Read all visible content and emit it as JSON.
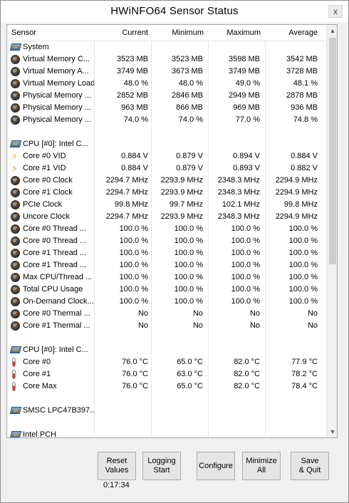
{
  "window": {
    "title": "HWiNFO64 Sensor Status",
    "close_label": "x"
  },
  "table": {
    "headers": {
      "sensor": "Sensor",
      "current": "Current",
      "minimum": "Minimum",
      "maximum": "Maximum",
      "average": "Average"
    },
    "rows": [
      {
        "type": "group",
        "icon": "chip-icon",
        "name": "System"
      },
      {
        "type": "sensor",
        "icon": "gauge-icon",
        "name": "Virtual Memory C...",
        "current": "3523 MB",
        "minimum": "3523 MB",
        "maximum": "3598 MB",
        "average": "3542 MB"
      },
      {
        "type": "sensor",
        "icon": "gauge-icon",
        "name": "Virtual Memory A...",
        "current": "3749 MB",
        "minimum": "3673 MB",
        "maximum": "3749 MB",
        "average": "3728 MB"
      },
      {
        "type": "sensor",
        "icon": "gauge-icon",
        "name": "Virtual Memory Load",
        "current": "48.0 %",
        "minimum": "48.0 %",
        "maximum": "49.0 %",
        "average": "48.1 %"
      },
      {
        "type": "sensor",
        "icon": "gauge-icon",
        "name": "Physical Memory ...",
        "current": "2852 MB",
        "minimum": "2846 MB",
        "maximum": "2949 MB",
        "average": "2878 MB"
      },
      {
        "type": "sensor",
        "icon": "gauge-icon",
        "name": "Physical Memory ...",
        "current": "963 MB",
        "minimum": "866 MB",
        "maximum": "969 MB",
        "average": "936 MB"
      },
      {
        "type": "sensor",
        "icon": "gauge-icon",
        "name": "Physical Memory ...",
        "current": "74.0 %",
        "minimum": "74.0 %",
        "maximum": "77.0 %",
        "average": "74.8 %"
      },
      {
        "type": "blank"
      },
      {
        "type": "group",
        "icon": "chip-icon",
        "name": "CPU [#0]: Intel C..."
      },
      {
        "type": "sensor",
        "icon": "bolt-icon",
        "name": "Core #0 VID",
        "current": "0.884 V",
        "minimum": "0.879 V",
        "maximum": "0.894 V",
        "average": "0.884 V"
      },
      {
        "type": "sensor",
        "icon": "bolt-icon",
        "name": "Core #1 VID",
        "current": "0.884 V",
        "minimum": "0.879 V",
        "maximum": "0.893 V",
        "average": "0.882 V"
      },
      {
        "type": "sensor",
        "icon": "gauge-icon",
        "name": "Core #0 Clock",
        "current": "2294.7 MHz",
        "minimum": "2293.9 MHz",
        "maximum": "2348.3 MHz",
        "average": "2294.9 MHz"
      },
      {
        "type": "sensor",
        "icon": "gauge-icon",
        "name": "Core #1 Clock",
        "current": "2294.7 MHz",
        "minimum": "2293.9 MHz",
        "maximum": "2348.3 MHz",
        "average": "2294.9 MHz"
      },
      {
        "type": "sensor",
        "icon": "gauge-icon",
        "name": "PCIe Clock",
        "current": "99.8 MHz",
        "minimum": "99.7 MHz",
        "maximum": "102.1 MHz",
        "average": "99.8 MHz"
      },
      {
        "type": "sensor",
        "icon": "gauge-icon",
        "name": "Uncore Clock",
        "current": "2294.7 MHz",
        "minimum": "2293.9 MHz",
        "maximum": "2348.3 MHz",
        "average": "2294.9 MHz"
      },
      {
        "type": "sensor",
        "icon": "gauge-icon",
        "name": "Core #0 Thread ...",
        "current": "100.0 %",
        "minimum": "100.0 %",
        "maximum": "100.0 %",
        "average": "100.0 %"
      },
      {
        "type": "sensor",
        "icon": "gauge-icon",
        "name": "Core #0 Thread ...",
        "current": "100.0 %",
        "minimum": "100.0 %",
        "maximum": "100.0 %",
        "average": "100.0 %"
      },
      {
        "type": "sensor",
        "icon": "gauge-icon",
        "name": "Core #1 Thread ...",
        "current": "100.0 %",
        "minimum": "100.0 %",
        "maximum": "100.0 %",
        "average": "100.0 %"
      },
      {
        "type": "sensor",
        "icon": "gauge-icon",
        "name": "Core #1 Thread ...",
        "current": "100.0 %",
        "minimum": "100.0 %",
        "maximum": "100.0 %",
        "average": "100.0 %"
      },
      {
        "type": "sensor",
        "icon": "gauge-icon",
        "name": "Max CPU/Thread ...",
        "current": "100.0 %",
        "minimum": "100.0 %",
        "maximum": "100.0 %",
        "average": "100.0 %"
      },
      {
        "type": "sensor",
        "icon": "gauge-icon",
        "name": "Total CPU Usage",
        "current": "100.0 %",
        "minimum": "100.0 %",
        "maximum": "100.0 %",
        "average": "100.0 %"
      },
      {
        "type": "sensor",
        "icon": "gauge-icon",
        "name": "On-Demand Clock...",
        "current": "100.0 %",
        "minimum": "100.0 %",
        "maximum": "100.0 %",
        "average": "100.0 %"
      },
      {
        "type": "sensor",
        "icon": "gauge-icon",
        "name": "Core #0 Thermal ...",
        "current": "No",
        "minimum": "No",
        "maximum": "No",
        "average": "No"
      },
      {
        "type": "sensor",
        "icon": "gauge-icon",
        "name": "Core #1 Thermal ...",
        "current": "No",
        "minimum": "No",
        "maximum": "No",
        "average": "No"
      },
      {
        "type": "blank"
      },
      {
        "type": "group",
        "icon": "chip-icon",
        "name": "CPU [#0]: Intel C..."
      },
      {
        "type": "sensor",
        "icon": "thermometer-icon",
        "name": "Core #0",
        "current": "76.0 °C",
        "minimum": "65.0 °C",
        "maximum": "82.0 °C",
        "average": "77.9 °C"
      },
      {
        "type": "sensor",
        "icon": "thermometer-icon",
        "name": "Core #1",
        "current": "76.0 °C",
        "minimum": "63.0 °C",
        "maximum": "82.0 °C",
        "average": "78.2 °C"
      },
      {
        "type": "sensor",
        "icon": "thermometer-icon",
        "name": "Core Max",
        "current": "76.0 °C",
        "minimum": "65.0 °C",
        "maximum": "82.0 °C",
        "average": "78.4 °C"
      },
      {
        "type": "blank"
      },
      {
        "type": "group",
        "icon": "chip-icon",
        "name": "SMSC LPC47B397..."
      },
      {
        "type": "blank"
      },
      {
        "type": "group",
        "icon": "chip-icon",
        "name": "Intel PCH"
      }
    ]
  },
  "buttons": [
    {
      "id": "reset-values-button",
      "line1": "Reset",
      "line2": "Values"
    },
    {
      "id": "logging-start-button",
      "line1": "Logging",
      "line2": "Start"
    },
    {
      "id": "configure-button",
      "line1": "Configure",
      "line2": ""
    },
    {
      "id": "minimize-all-button",
      "line1": "Minimize",
      "line2": "All"
    },
    {
      "id": "save-quit-button",
      "line1": "Save",
      "line2": "& Quit"
    }
  ],
  "timer": "0:17:34",
  "colors": {
    "window_bg": "#f0f0f0",
    "table_bg": "#ffffff",
    "button_bg": "#e5e5e5"
  }
}
